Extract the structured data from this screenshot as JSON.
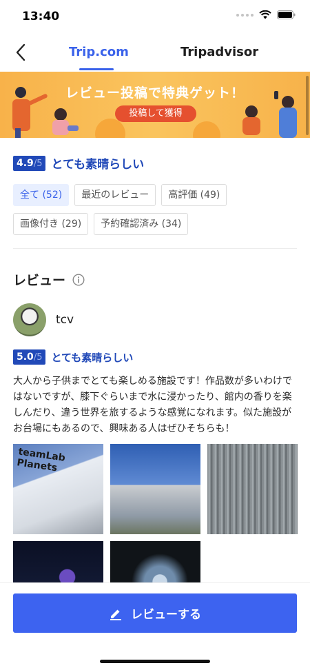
{
  "status": {
    "time": "13:40"
  },
  "nav": {
    "tabs": [
      {
        "label": "Trip.com",
        "active": true
      },
      {
        "label": "Tripadvisor",
        "active": false
      }
    ]
  },
  "banner": {
    "title": "レビュー投稿で特典ゲット！",
    "button": "投稿して獲得"
  },
  "summary": {
    "score": "4.9",
    "max": "/5",
    "label": "とても素晴らしい"
  },
  "filters": [
    [
      {
        "label": "全て (52)",
        "active": true
      },
      {
        "label": "最近のレビュー"
      },
      {
        "label": "高評価 (49)"
      }
    ],
    [
      {
        "label": "画像付き (29)"
      },
      {
        "label": "予約確認済み (34)"
      }
    ]
  ],
  "section": {
    "title": "レビュー",
    "info_icon": "info-icon"
  },
  "review": {
    "user": "tcv",
    "score": "5.0",
    "max": "/5",
    "label": "とても素晴らしい",
    "text": "大人から子供までとても楽しめる施設です！作品数が多いわけではないですが、膝下ぐらいまで水に浸かったり、館内の香りを楽しんだり、違う世界を旅するような感覚になれます。似た施設がお台場にもあるので、興味ある人はぜひそちらも！",
    "photo_caption": "teamLab Planets"
  },
  "cta": {
    "label": "レビューする",
    "icon": "edit-icon"
  },
  "colors": {
    "accent": "#3a62ea",
    "score_bg": "#2149b8",
    "cta": "#3d63f0"
  }
}
